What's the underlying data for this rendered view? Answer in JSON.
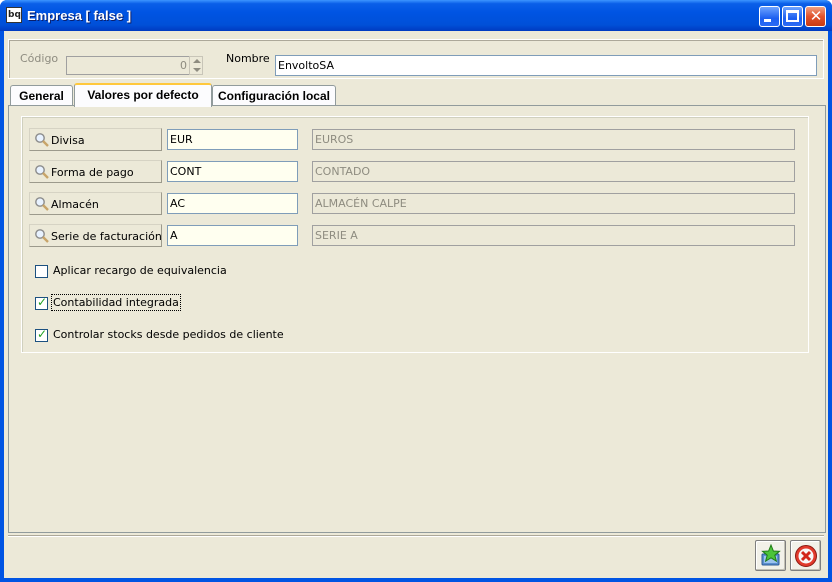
{
  "window": {
    "title": "Empresa [ false ]",
    "app_icon_text": "bq"
  },
  "header": {
    "codigo_label": "Código",
    "codigo_value": "0",
    "nombre_label": "Nombre",
    "nombre_value": "EnvoltoSA"
  },
  "tabs": [
    {
      "label": "General",
      "active": false
    },
    {
      "label": "Valores por defecto",
      "active": true
    },
    {
      "label": "Configuración local",
      "active": false
    }
  ],
  "defaults": {
    "fields": [
      {
        "label": "Divisa",
        "code": "EUR",
        "description": "EUROS"
      },
      {
        "label": "Forma de pago",
        "code": "CONT",
        "description": "CONTADO"
      },
      {
        "label": "Almacén",
        "code": "AC",
        "description": "ALMACÉN CALPE"
      },
      {
        "label": "Serie de facturación",
        "code": "A",
        "description": "SERIE A"
      }
    ],
    "checkboxes": [
      {
        "label": "Aplicar recargo de equivalencia",
        "checked": false
      },
      {
        "label": "Contabilidad integrada",
        "checked": true
      },
      {
        "label": "Controlar stocks desde pedidos de cliente",
        "checked": true
      }
    ]
  },
  "actions": {
    "accept_icon": "accept-star-icon",
    "cancel_icon": "cancel-icon"
  },
  "colors": {
    "titlebar": "#0054e3",
    "face": "#ece9d8",
    "active_tab_highlight": "#ffc83c"
  }
}
